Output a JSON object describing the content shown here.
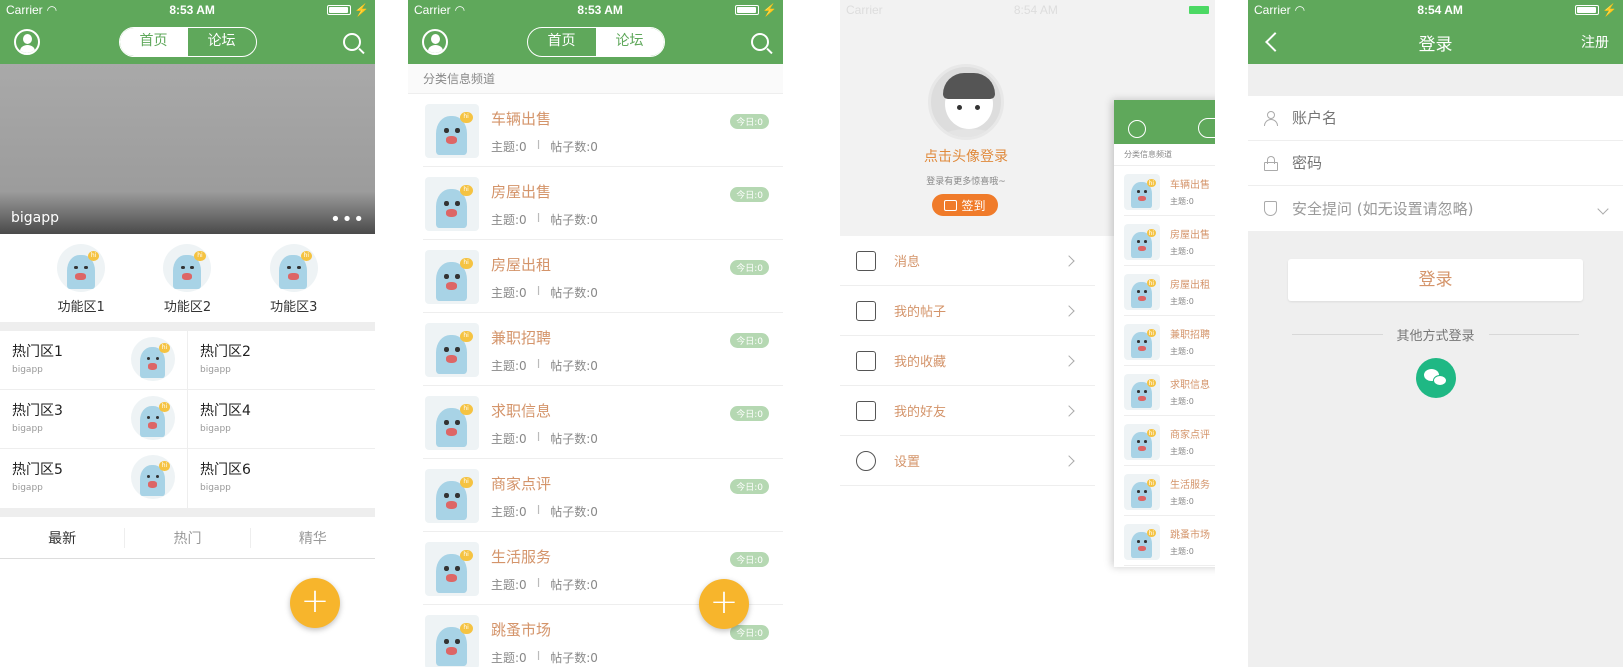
{
  "status": {
    "carrier": "Carrier",
    "time1": "8:53 AM",
    "time2": "8:53 AM",
    "time3": "8:54 AM",
    "time4": "8:54 AM"
  },
  "nav": {
    "tab_home": "首页",
    "tab_forum": "论坛"
  },
  "home": {
    "banner_label": "bigapp",
    "features": [
      "功能区1",
      "功能区2",
      "功能区3"
    ],
    "hot": [
      {
        "title": "热门区1",
        "sub": "bigapp"
      },
      {
        "title": "热门区2",
        "sub": "bigapp"
      },
      {
        "title": "热门区3",
        "sub": "bigapp"
      },
      {
        "title": "热门区4",
        "sub": "bigapp"
      },
      {
        "title": "热门区5",
        "sub": "bigapp"
      },
      {
        "title": "热门区6",
        "sub": "bigapp"
      }
    ],
    "tabs": [
      "最新",
      "热门",
      "精华"
    ]
  },
  "forum": {
    "section": "分类信息频道",
    "items": [
      {
        "name": "车辆出售",
        "badge": "今日:0",
        "topics": "主题:0",
        "posts": "帖子数:0"
      },
      {
        "name": "房屋出售",
        "badge": "今日:0",
        "topics": "主题:0",
        "posts": "帖子数:0"
      },
      {
        "name": "房屋出租",
        "badge": "今日:0",
        "topics": "主题:0",
        "posts": "帖子数:0"
      },
      {
        "name": "兼职招聘",
        "badge": "今日:0",
        "topics": "主题:0",
        "posts": "帖子数:0"
      },
      {
        "name": "求职信息",
        "badge": "今日:0",
        "topics": "主题:0",
        "posts": "帖子数:0"
      },
      {
        "name": "商家点评",
        "badge": "今日:0",
        "topics": "主题:0",
        "posts": "帖子数:0"
      },
      {
        "name": "生活服务",
        "badge": "今日:0",
        "topics": "主题:0",
        "posts": "帖子数:0"
      },
      {
        "name": "跳蚤市场",
        "badge": "今日:0",
        "topics": "主题:0",
        "posts": "帖子数:0"
      }
    ],
    "sep": "I"
  },
  "menu": {
    "login_prompt": "点击头像登录",
    "login_hint": "登录有更多惊喜哦~",
    "signin": "签到",
    "items": [
      {
        "label": "消息",
        "icon": "message-icon"
      },
      {
        "label": "我的帖子",
        "icon": "document-icon"
      },
      {
        "label": "我的收藏",
        "icon": "star-icon"
      },
      {
        "label": "我的好友",
        "icon": "friends-icon"
      },
      {
        "label": "设置",
        "icon": "gear-icon"
      }
    ],
    "preview_items": [
      "车辆出售",
      "房屋出售",
      "房屋出租",
      "兼职招聘",
      "求职信息",
      "商家点评",
      "生活服务",
      "跳蚤市场"
    ],
    "preview_sub": "主题:0"
  },
  "login": {
    "title": "登录",
    "register": "注册",
    "username_placeholder": "账户名",
    "password_placeholder": "密码",
    "security_placeholder": "安全提问 (如无设置请忽略)",
    "login_button": "登录",
    "other_methods": "其他方式登录"
  },
  "colors": {
    "green": "#5fa85b",
    "orange": "#f07b2a",
    "fab": "#f7b52c",
    "wechat": "#1fb884"
  }
}
